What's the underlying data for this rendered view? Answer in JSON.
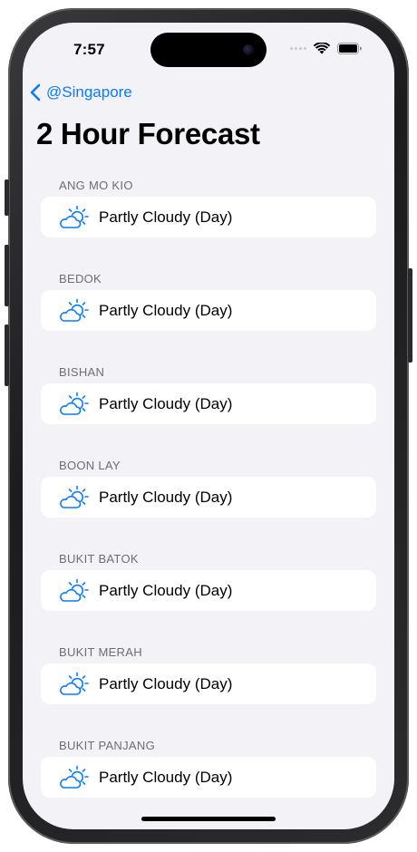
{
  "status_bar": {
    "time": "7:57"
  },
  "navigation": {
    "back_label": "@Singapore",
    "title": "2 Hour Forecast"
  },
  "accent_color": "#0a7aff",
  "areas": [
    {
      "name": "ANG MO KIO",
      "forecast": "Partly Cloudy (Day)",
      "icon": "partly-cloudy-day-icon"
    },
    {
      "name": "BEDOK",
      "forecast": "Partly Cloudy (Day)",
      "icon": "partly-cloudy-day-icon"
    },
    {
      "name": "BISHAN",
      "forecast": "Partly Cloudy (Day)",
      "icon": "partly-cloudy-day-icon"
    },
    {
      "name": "BOON LAY",
      "forecast": "Partly Cloudy (Day)",
      "icon": "partly-cloudy-day-icon"
    },
    {
      "name": "BUKIT BATOK",
      "forecast": "Partly Cloudy (Day)",
      "icon": "partly-cloudy-day-icon"
    },
    {
      "name": "BUKIT MERAH",
      "forecast": "Partly Cloudy (Day)",
      "icon": "partly-cloudy-day-icon"
    },
    {
      "name": "BUKIT PANJANG",
      "forecast": "Partly Cloudy (Day)",
      "icon": "partly-cloudy-day-icon"
    }
  ]
}
